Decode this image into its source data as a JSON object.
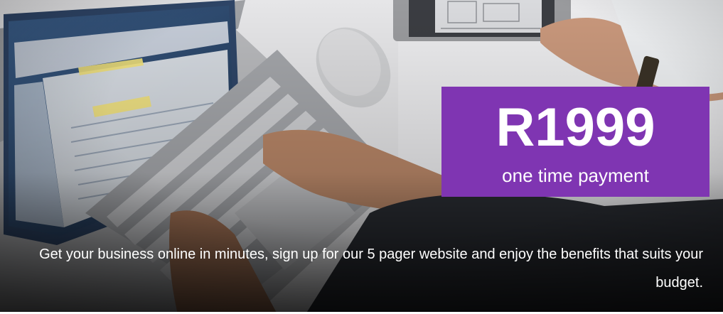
{
  "banner": {
    "price": "R1999",
    "price_subtitle": "one time payment",
    "tagline": "Get your business online in minutes, sign up for our 5 pager website and enjoy the benefits that suits your budget.",
    "colors": {
      "price_box": "#7f35b2",
      "text": "#ffffff"
    },
    "image_description_icons": [
      "laptop-illustration",
      "mouse-illustration",
      "tablet-illustration",
      "hands-illustration"
    ]
  }
}
